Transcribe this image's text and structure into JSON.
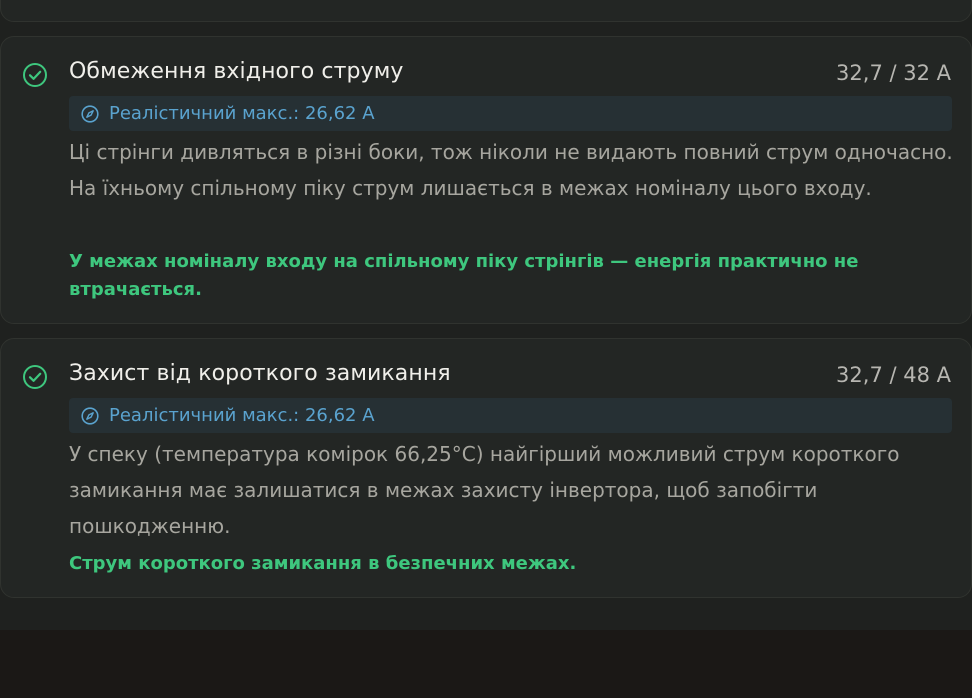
{
  "checks": [
    {
      "title": "Обмеження вхідного струму",
      "metric": "32,7 / 32 A",
      "hint": "Реалістичний макс.: 26,62 A",
      "description": "Ці стрінги дивляться в різні боки, тож ніколи не видають повний струм одночасно. На їхньому спільному піку струм лишається в межах номіналу цього входу.",
      "verdict": "У межах номіналу входу на спільному піку стрінгів — енергія практично не втрачається.",
      "status_icon": "check-circle-icon",
      "hint_icon": "compass-icon"
    },
    {
      "title": "Захист від короткого замикання",
      "metric": "32,7 / 48 A",
      "hint": "Реалістичний макс.: 26,62 A",
      "description": "У спеку (температура комірок 66,25°C) найгірший можливий струм короткого замикання має залишатися в межах захисту інвертора, щоб запобігти пошкодженню.",
      "verdict": "Струм короткого замикання в безпечних межах.",
      "status_icon": "check-circle-icon",
      "hint_icon": "compass-icon"
    }
  ],
  "colors": {
    "success": "#3ec77e",
    "hint": "#5aa3cf",
    "card_bg": "#232624",
    "page_bg": "#1b1816"
  }
}
